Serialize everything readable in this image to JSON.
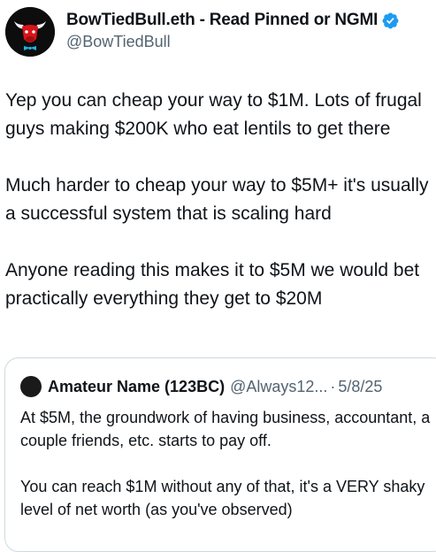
{
  "author": {
    "display_name": "BowTiedBull.eth - Read Pinned or NGMI",
    "handle": "@BowTiedBull",
    "avatar_icon": "red-bull-avatar-icon",
    "verified_icon": "verified-badge-icon",
    "verified_color": "#1d9bf0"
  },
  "tweet": {
    "paragraphs": [
      "Yep you can cheap your way to $1M. Lots of frugal guys making $200K who eat lentils to get there",
      "Much harder to cheap your way to $5M+ it's usually a successful system that is scaling hard",
      "Anyone reading this makes it to $5M we would bet practically everything they get to $20M"
    ]
  },
  "quote": {
    "display_name": "Amateur Name (123BC)",
    "handle": "@Always12...",
    "separator": "·",
    "date": "5/8/25",
    "paragraphs": [
      "At $5M, the groundwork of having business, accountant, a couple friends, etc. starts to pay off.",
      "You can reach $1M without any of that, it's a VERY shaky level of net worth (as you've observed)"
    ]
  }
}
